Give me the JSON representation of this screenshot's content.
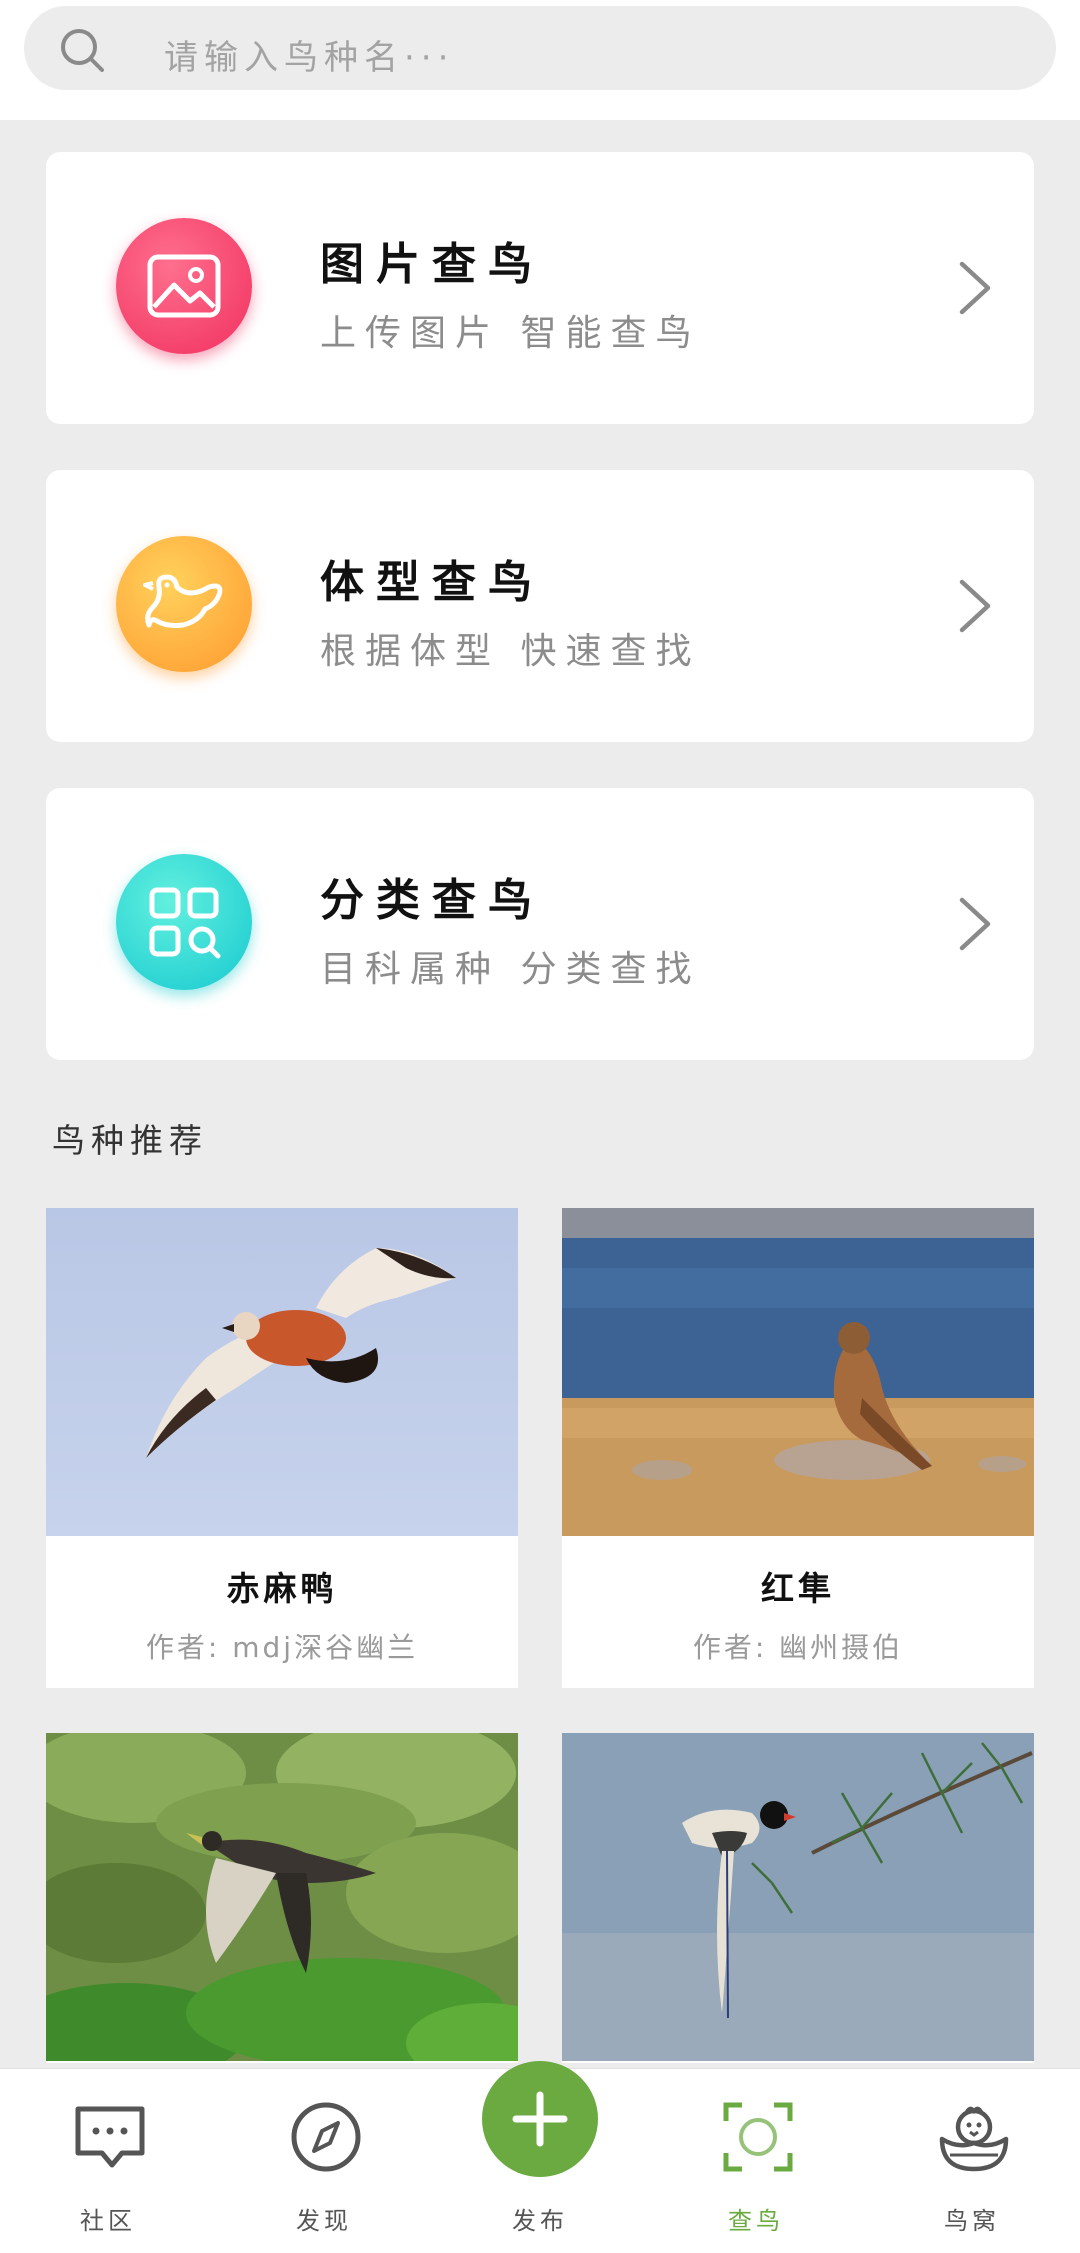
{
  "search": {
    "placeholder": "请输入鸟种名···"
  },
  "features": [
    {
      "title": "图片查鸟",
      "subtitle": "上传图片 智能查鸟",
      "icon": "image-icon"
    },
    {
      "title": "体型查鸟",
      "subtitle": "根据体型 快速查找",
      "icon": "bird-icon"
    },
    {
      "title": "分类查鸟",
      "subtitle": "目科属种 分类查找",
      "icon": "category-grid-icon"
    }
  ],
  "recommend": {
    "title": "鸟种推荐",
    "birds": [
      {
        "name": "赤麻鸭",
        "author": "作者: mdj深谷幽兰"
      },
      {
        "name": "红隼",
        "author": "作者: 幽州摄伯"
      },
      {
        "name": "",
        "author": ""
      },
      {
        "name": "",
        "author": ""
      }
    ]
  },
  "nav": {
    "items": [
      {
        "label": "社区",
        "icon": "community-chat-icon"
      },
      {
        "label": "发现",
        "icon": "compass-icon"
      },
      {
        "label": "发布",
        "icon": "plus-icon"
      },
      {
        "label": "查鸟",
        "icon": "scan-icon"
      },
      {
        "label": "鸟窝",
        "icon": "bird-nest-icon"
      }
    ],
    "active": "查鸟",
    "accent": "#6aaa40"
  }
}
